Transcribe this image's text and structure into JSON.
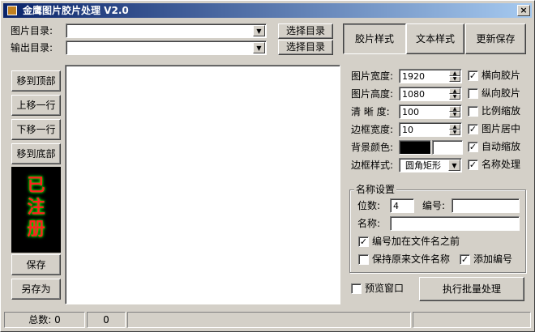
{
  "window": {
    "title": "金鹰图片胶片处理 V2.0",
    "close": "×"
  },
  "dirs": {
    "image_dir_label": "图片目录:",
    "output_dir_label": "输出目录:",
    "image_dir_value": "",
    "output_dir_value": "",
    "select_label": "选择目录"
  },
  "tabs": [
    "胶片样式",
    "文本样式",
    "更新保存"
  ],
  "left_buttons": [
    "移到顶部",
    "上移一行",
    "下移一行",
    "移到底部"
  ],
  "registered": [
    "已",
    "注",
    "册"
  ],
  "save": "保存",
  "save_as": "另存为",
  "settings": {
    "width_label": "图片宽度:",
    "width_value": "1920",
    "height_label": "图片高度:",
    "height_value": "1080",
    "clarity_label": "清 晰 度:",
    "clarity_value": "100",
    "border_label": "边框宽度:",
    "border_value": "10",
    "bg_label": "背景颜色:",
    "style_label": "边框样式:",
    "style_value": "圆角矩形"
  },
  "checks": [
    {
      "label": "横向胶片",
      "checked": true
    },
    {
      "label": "纵向胶片",
      "checked": false
    },
    {
      "label": "比例缩放",
      "checked": false
    },
    {
      "label": "图片居中",
      "checked": true
    },
    {
      "label": "自动缩放",
      "checked": true
    },
    {
      "label": "名称处理",
      "checked": true
    }
  ],
  "naming": {
    "title": "名称设置",
    "digits_label": "位数:",
    "digits_value": "4",
    "number_label": "编号:",
    "number_value": "",
    "name_label": "名称:",
    "name_value": "",
    "opt1": "编号加在文件名之前",
    "opt2": "保持原来文件名称",
    "opt3": "添加编号",
    "opt1_checked": true,
    "opt2_checked": false,
    "opt3_checked": true
  },
  "preview": "预览窗口",
  "run": "执行批量处理",
  "status": {
    "total": "总数: 0",
    "count": "0"
  },
  "colors": {
    "bg_color": "#000000"
  }
}
